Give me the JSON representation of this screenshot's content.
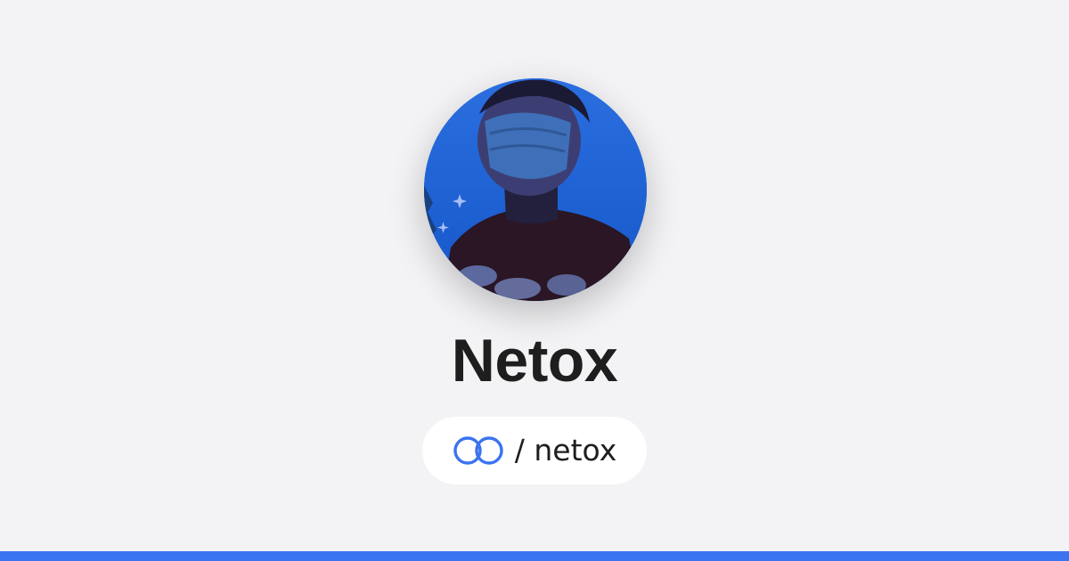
{
  "profile": {
    "display_name": "Netox",
    "handle": "/ netox",
    "avatar_description": "profile-photo"
  },
  "icons": {
    "logo": "linked-rings-icon"
  },
  "colors": {
    "background": "#f3f3f5",
    "accent": "#3b73f0",
    "text": "#1e1e1e",
    "pill": "#ffffff"
  }
}
